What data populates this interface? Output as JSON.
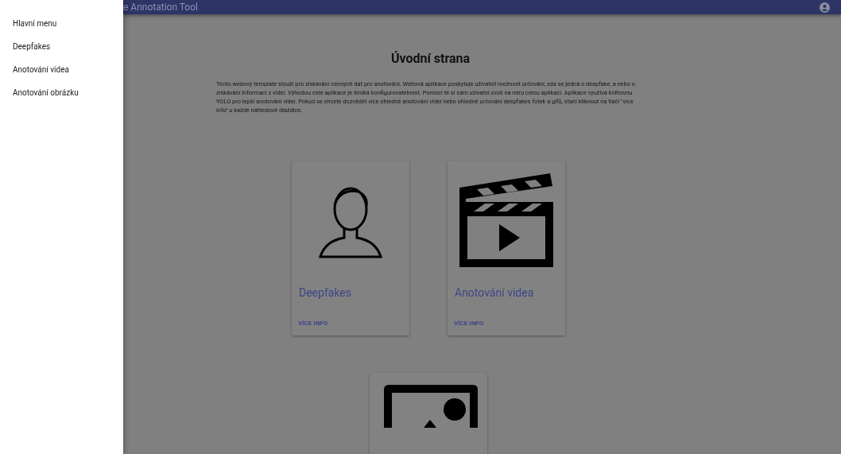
{
  "drawer": {
    "items": [
      {
        "label": "Hlavní menu"
      },
      {
        "label": "Deepfakes"
      },
      {
        "label": "Anotování videa"
      },
      {
        "label": "Anotování obrázku"
      }
    ]
  },
  "app_bar": {
    "title": "e Annotation Tool"
  },
  "page": {
    "heading": "Úvodní strana",
    "intro": "Tento webový template slouží pro získávání cenných dat pro anotování. Webová aplikace poskytuje uživateli možnost určování, zda se jedná o deepfake, a nebo o získávání informací z videí. Výhodou celé aplikace je široká konfigurovatelnost. Pomocí té si sám uživatel zvolí na míru celou aplikaci. Aplikace využívá knihovnu YOLO pro lepší anotování videí. Pokud se chcete dozvědět více ohledně anotování videí nebo ohledně určování deepfakes fotek a gifů, stačí kliknout na tlačí \"více info\" u každé náhledové dlaždice."
  },
  "cards": [
    {
      "kind": "person",
      "title": "Deepfakes",
      "action": "VÍCE INFO"
    },
    {
      "kind": "clapperboard",
      "title": "Anotování videa",
      "action": "VÍCE INFO"
    },
    {
      "kind": "image"
    }
  ]
}
